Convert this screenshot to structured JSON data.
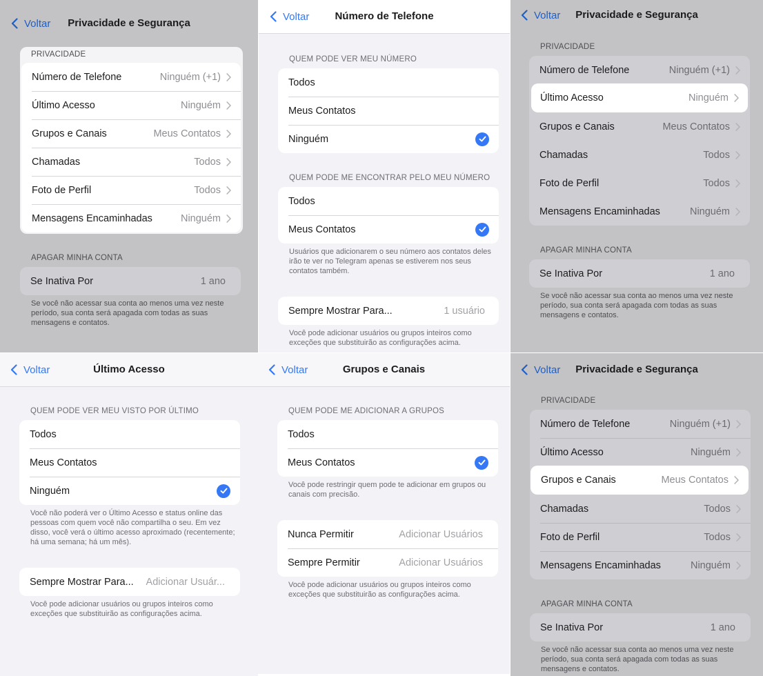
{
  "common": {
    "back_label": "Voltar"
  },
  "panel1": {
    "title": "Privacidade e Segurança",
    "privacy_section": "PRIVACIDADE",
    "items": [
      {
        "label": "Número de Telefone",
        "value": "Ninguém (+1)"
      },
      {
        "label": "Último Acesso",
        "value": "Ninguém"
      },
      {
        "label": "Grupos e Canais",
        "value": "Meus Contatos"
      },
      {
        "label": "Chamadas",
        "value": "Todos"
      },
      {
        "label": "Foto de Perfil",
        "value": "Todos"
      },
      {
        "label": "Mensagens Encaminhadas",
        "value": "Ninguém"
      }
    ],
    "delete_section": "APAGAR MINHA CONTA",
    "inactive_label": "Se Inativa Por",
    "inactive_value": "1 ano",
    "delete_footer": "Se você não acessar sua conta ao menos uma vez neste período, sua conta será apagada com todas as suas mensagens e contatos."
  },
  "panel2": {
    "title": "Número de Telefone",
    "see_section": "QUEM PODE VER MEU NÚMERO",
    "see_options": [
      "Todos",
      "Meus Contatos",
      "Ninguém"
    ],
    "find_section": "QUEM PODE ME ENCONTRAR PELO MEU NÚMERO",
    "find_options": [
      "Todos",
      "Meus Contatos"
    ],
    "find_footer": "Usuários que adicionarem o seu número aos contatos deles irão te ver no Telegram apenas se estiverem nos seus contatos também.",
    "always_label": "Sempre Mostrar Para...",
    "always_value": "1 usuário",
    "exceptions_footer": "Você pode adicionar usuários ou grupos inteiros como exceções que substituirão as configurações acima."
  },
  "panel4": {
    "title": "Último Acesso",
    "section": "QUEM PODE VER MEU VISTO POR ÚLTIMO",
    "options": [
      "Todos",
      "Meus Contatos",
      "Ninguém"
    ],
    "footer": "Você não poderá ver o Último Acesso e status online das pessoas com quem você não compartilha o seu. Em vez disso, você verá o último acesso aproximado (recentemente; há uma semana; há um mês).",
    "always_label": "Sempre Mostrar Para...",
    "always_value": "Adicionar Usuár...",
    "exceptions_footer": "Você pode adicionar usuários ou grupos inteiros como exceções que substituirão as configurações acima."
  },
  "panel5": {
    "title": "Grupos e Canais",
    "section": "QUEM PODE ME ADICIONAR A GRUPOS",
    "options": [
      "Todos",
      "Meus Contatos"
    ],
    "footer": "Você pode restringir quem pode te adicionar em grupos ou canais com precisão.",
    "never_label": "Nunca Permitir",
    "never_value": "Adicionar Usuários",
    "always_label": "Sempre Permitir",
    "always_value": "Adicionar Usuários",
    "exceptions_footer": "Você pode adicionar usuários ou grupos inteiros como exceções que substituirão as configurações acima."
  },
  "colors": {
    "accent": "#3478f6",
    "dim_background": "#c3c3c6",
    "grouped_background": "#f2f2f7"
  },
  "icons": {
    "back": "chevron-left-icon",
    "disclosure": "chevron-right-icon",
    "selected": "checkmark-circle-icon"
  }
}
